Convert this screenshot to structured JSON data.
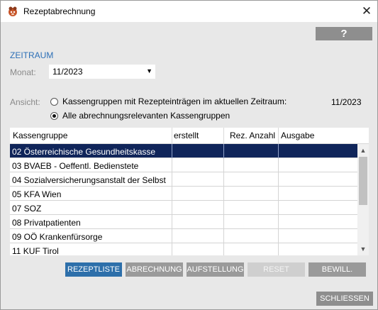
{
  "window": {
    "title": "Rezeptabrechnung",
    "close_glyph": "✕"
  },
  "help": {
    "label": "?"
  },
  "zeitraum": {
    "section_title": "ZEITRAUM",
    "monat_label": "Monat:",
    "monat_value": "11/2023"
  },
  "ansicht": {
    "label": "Ansicht:",
    "options": [
      {
        "label": "Kassengruppen mit Rezepteinträgen im aktuellen Zeitraum:",
        "checked": false
      },
      {
        "label": "Alle abrechnungsrelevanten Kassengruppen",
        "checked": true
      }
    ],
    "period": "11/2023"
  },
  "table": {
    "headers": [
      "Kassengruppe",
      "erstellt",
      "Rez. Anzahl",
      "Ausgabe"
    ],
    "rows": [
      {
        "name": "02  Österreichische Gesundheitskasse",
        "selected": true
      },
      {
        "name": "03  BVAEB - Oeffentl. Bedienstete",
        "selected": false
      },
      {
        "name": "04  Sozialversicherungsanstalt der Selbst",
        "selected": false
      },
      {
        "name": "05  KFA Wien",
        "selected": false
      },
      {
        "name": "07  SOZ",
        "selected": false
      },
      {
        "name": "08  Privatpatienten",
        "selected": false
      },
      {
        "name": "09  OÖ Krankenfürsorge",
        "selected": false
      },
      {
        "name": "11  KUF Tirol",
        "selected": false
      }
    ]
  },
  "buttons": {
    "rezeptliste": "REZEPTLISTE",
    "abrechnung": "ABRECHNUNG",
    "aufstellung": "AUFSTELLUNG",
    "reset": "RESET",
    "bewill": "BEWILL.",
    "schliessen": "SCHLIESSEN"
  },
  "colors": {
    "accent": "#2d6faa",
    "selected_row": "#10255a",
    "section_title": "#2c6fb6"
  }
}
